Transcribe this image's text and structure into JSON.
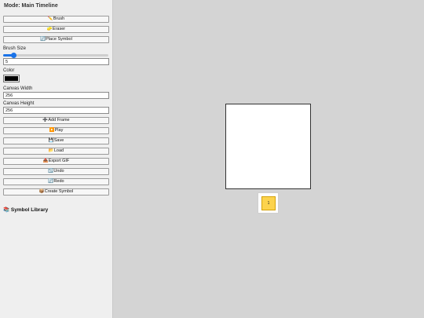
{
  "sidebar": {
    "mode_title": "Mode: Main Timeline",
    "tools": {
      "brush": {
        "label": "Brush",
        "icon": "✏️"
      },
      "eraser": {
        "label": "Eraser",
        "icon": "🧽"
      },
      "place_symbol": {
        "label": "Place Symbol",
        "icon": "🔄"
      }
    },
    "brush_size": {
      "label": "Brush Size",
      "value": "5",
      "slider_fraction": 0.1
    },
    "color": {
      "label": "Color",
      "value": "#000000"
    },
    "canvas_width": {
      "label": "Canvas Width",
      "value": "256"
    },
    "canvas_height": {
      "label": "Canvas Height",
      "value": "256"
    },
    "actions": {
      "add_frame": {
        "label": "Add Frame",
        "icon": "➕"
      },
      "play": {
        "label": "Play",
        "icon": "▶️"
      },
      "save": {
        "label": "Save",
        "icon": "💾"
      },
      "load": {
        "label": "Load",
        "icon": "📂"
      },
      "export_gif": {
        "label": "Export GIF",
        "icon": "📤"
      },
      "undo": {
        "label": "Undo",
        "icon": "↩️"
      },
      "redo": {
        "label": "Redo",
        "icon": "🔄"
      },
      "create_symbol": {
        "label": "Create Symbol",
        "icon": "📦"
      }
    },
    "symbol_library": {
      "title": "Symbol Library",
      "icon": "📚"
    }
  },
  "timeline": {
    "frames": [
      {
        "number": "1"
      }
    ],
    "active_frame_color": "#fcd34d"
  }
}
